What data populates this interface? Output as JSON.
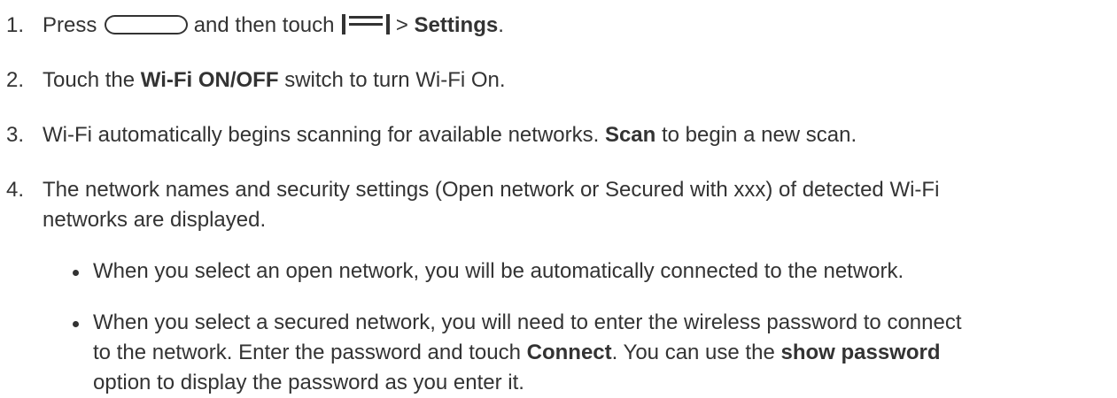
{
  "steps": [
    {
      "num": "1.",
      "t1": "Press",
      "home_button_icon": "home-button-icon",
      "t2": "and then touch",
      "menu_icon": "menu-icon",
      "t3": ">",
      "b1": "Settings",
      "t4": "."
    },
    {
      "num": "2.",
      "t1": "Touch the",
      "b1": "Wi-Fi ON/OFF",
      "t2": "switch to turn Wi-Fi On."
    },
    {
      "num": "3.",
      "t1": "Wi-Fi automatically begins scanning for available networks.",
      "b1": "Scan",
      "t2": "to begin a new scan."
    },
    {
      "num": "4.",
      "line1": "The network names and security settings (Open network or Secured with xxx) of detected Wi-Fi",
      "line2": "networks are displayed."
    }
  ],
  "bullets": [
    {
      "line1": "When you select an open network, you will be automatically connected to the network."
    },
    {
      "line1": "When you select a secured network, you will need to enter the wireless password to connect",
      "l2_t1": "to the network. Enter the password and touch",
      "l2_b1": "Connect",
      "l2_t2": ". You can use the",
      "l2_b2": "show password",
      "line3": "option to display the password as you enter it."
    }
  ]
}
